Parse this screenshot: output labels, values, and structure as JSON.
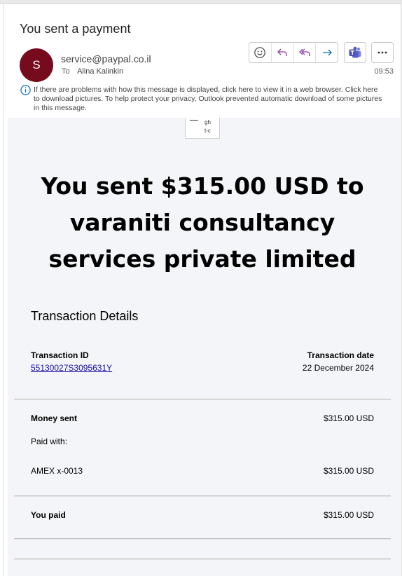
{
  "message": {
    "subject": "You sent a payment",
    "avatar_initial": "S",
    "avatar_color": "#750b1c",
    "sender": "service@paypal.co.il",
    "to_label": "To",
    "to_name": "Alina Kalinkin",
    "time": "09:53",
    "info_notice": "If there are problems with how this message is displayed, click here to view it in a web browser. Click here to download pictures. To help protect your privacy, Outlook prevented automatic download of some pictures in this message."
  },
  "toolbar": {
    "icons": [
      "emoji-icon",
      "reply-icon",
      "reply-all-icon",
      "forward-icon",
      "teams-icon",
      "more-icon"
    ]
  },
  "body": {
    "broken_image_alt": "gh\nt-c",
    "headline": "You sent $315.00 USD to varaniti consultancy services private limited",
    "section_title": "Transaction Details",
    "transaction_id_label": "Transaction ID",
    "transaction_id": "55130027S3095631Y",
    "transaction_date_label": "Transaction date",
    "transaction_date": "22 December 2024",
    "money_sent_label": "Money sent",
    "money_sent_amount": "$315.00 USD",
    "paid_with_label": "Paid with:",
    "card_label": "AMEX x-0013",
    "card_amount": "$315.00 USD",
    "you_paid_label": "You paid",
    "you_paid_amount": "$315.00 USD"
  },
  "colors": {
    "body_background": "#f4f5f8",
    "link": "#1a0dab",
    "accent": "#5b5fc7"
  }
}
